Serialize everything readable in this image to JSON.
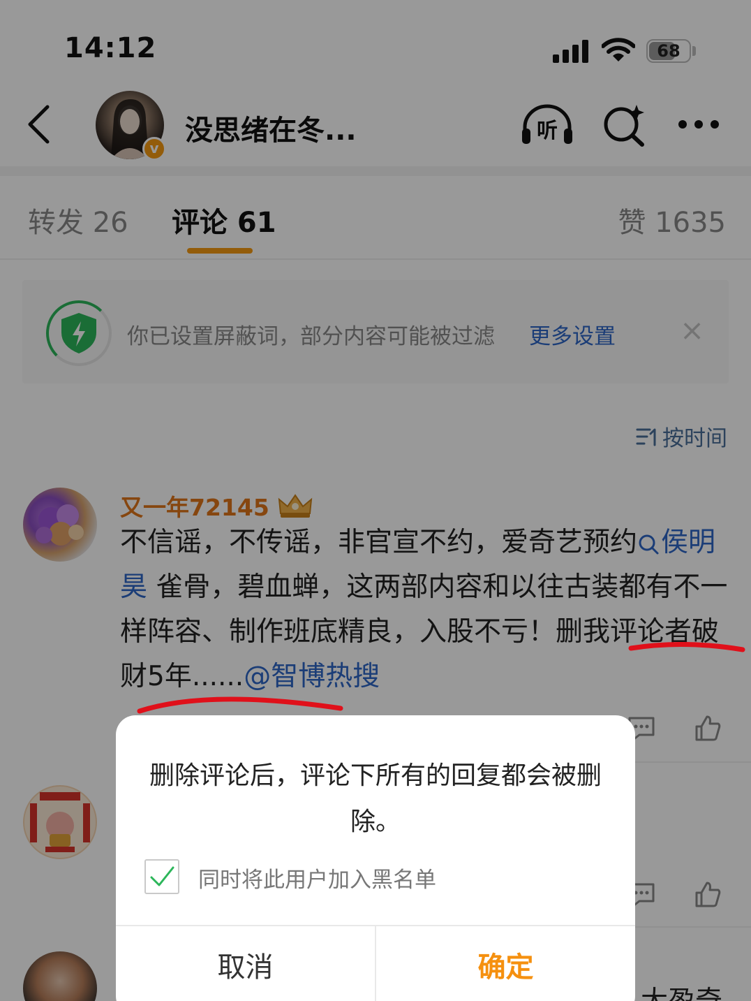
{
  "status_bar": {
    "time": "14:12",
    "battery": "68",
    "battery_level": 0.68
  },
  "header": {
    "title": "没思绪在冬...",
    "back_icon": "chevron-left-icon",
    "listen_icon": "headphones-icon",
    "listen_label": "听",
    "search_icon": "search-icon",
    "more_icon": "more-icon"
  },
  "tabs": [
    {
      "label": "转发 26"
    },
    {
      "label": "评论 61"
    },
    {
      "label": "赞 1635"
    }
  ],
  "notice": {
    "text": "你已设置屏蔽词，部分内容可能被过滤",
    "link": "更多设置",
    "close": "×"
  },
  "sort_label": "按时间",
  "comment": {
    "username": "又一年72145",
    "text_1": "不信谣，不传谣，非官宣不约，爱奇艺预约",
    "mention_topic": "侯明昊",
    "text_2": " 雀骨，碧血蝉，这两部内容和以往古装都有不一样阵容、制作班底精良，入股不亏！删我评论者破财5年......",
    "mention_user": "@智博热搜"
  },
  "partial_text": "大盈奇",
  "dialog": {
    "message": "删除评论后，评论下所有的回复都会被删除。",
    "checkbox_label": "同时将此用户加入黑名单",
    "checked": true,
    "cancel": "取消",
    "confirm": "确定"
  },
  "colors": {
    "accent": "#f59a12",
    "link": "#2d66c6",
    "username": "#e0761a",
    "confirm": "#f5900f",
    "annotation": "#e0101a"
  }
}
